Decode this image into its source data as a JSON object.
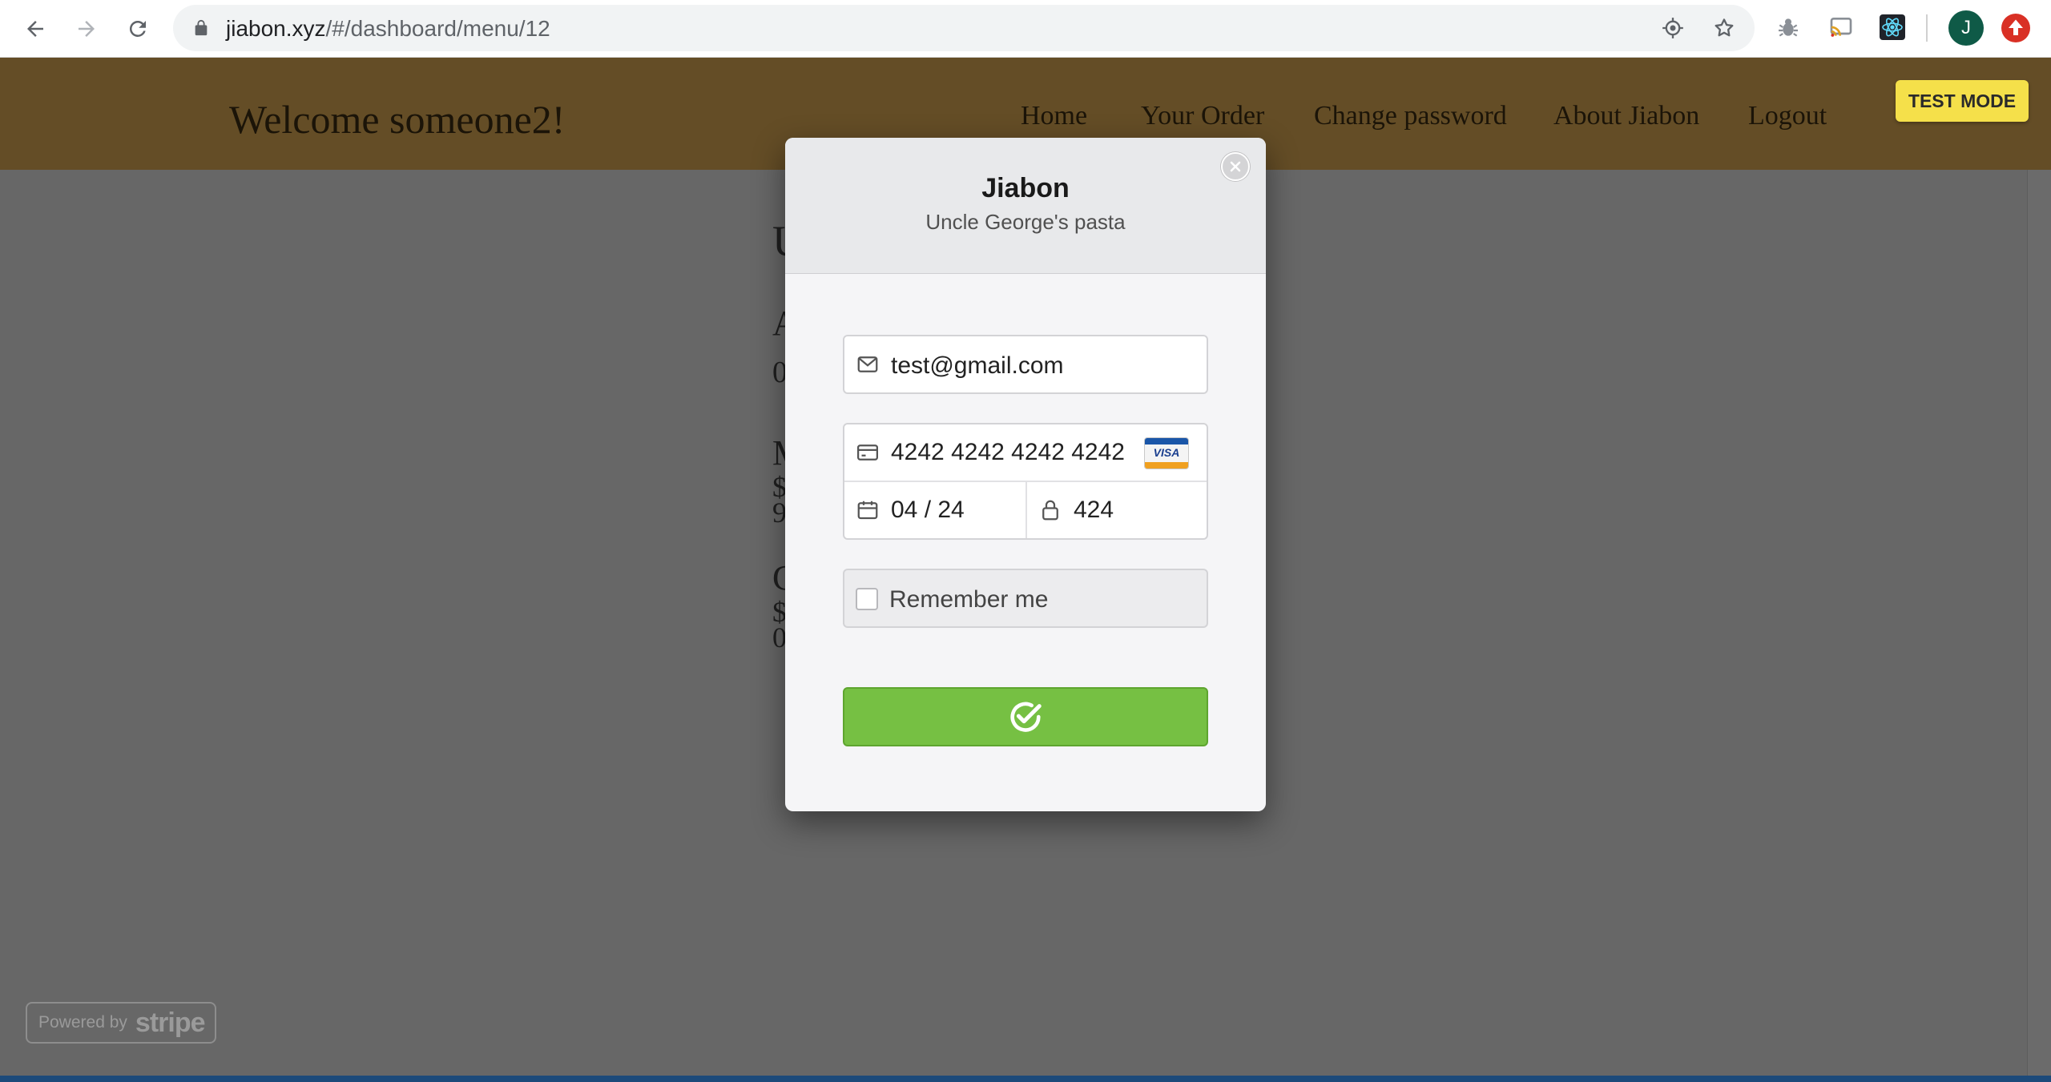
{
  "browser": {
    "url_host": "jiabon.xyz",
    "url_path": "/#/dashboard/menu/12",
    "profile_initial": "J",
    "icons": [
      "back-arrow-icon",
      "forward-arrow-icon",
      "reload-icon",
      "lock-icon",
      "location-icon",
      "star-icon",
      "bug-extension-icon",
      "cast-extension-icon",
      "react-devtools-icon",
      "update-icon"
    ]
  },
  "site": {
    "welcome": "Welcome someone2!",
    "nav": [
      "Home",
      "Your Order",
      "Change password",
      "About Jiabon",
      "Logout"
    ],
    "test_mode": "TEST MODE",
    "background_letters": [
      "U",
      "A",
      "0",
      "M",
      "$",
      "9",
      "C",
      "$",
      "0"
    ]
  },
  "checkout": {
    "title": "Jiabon",
    "subtitle": "Uncle George's pasta",
    "email": "test@gmail.com",
    "card_number": "4242 4242 4242 4242",
    "card_brand": "VISA",
    "expiry": "04 / 24",
    "cvc": "424",
    "remember_me": "Remember me",
    "remember_checked": false,
    "submit_icon": "checkmark-circle-icon"
  },
  "powered_by": {
    "prefix": "Powered by",
    "brand": "stripe"
  },
  "colors": {
    "header_bg": "#644d26",
    "overlay_bg": "#676767",
    "test_mode_bg": "#f5e04a",
    "pay_button": "#76c043"
  }
}
